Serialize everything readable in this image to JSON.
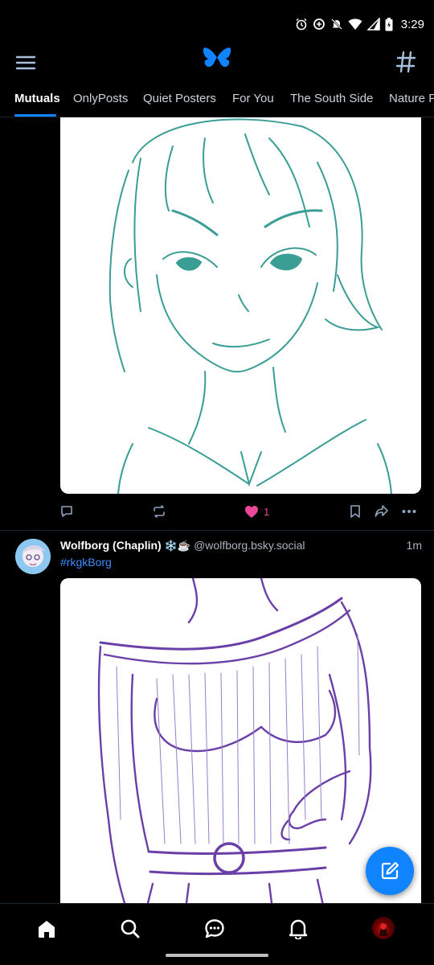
{
  "status_bar": {
    "time": "3:29",
    "icons": [
      "alarm-icon",
      "data-saver-icon",
      "bell-off-icon",
      "wifi-icon",
      "signal-icon",
      "battery-icon"
    ]
  },
  "header": {
    "menu_icon": "hamburger-menu-icon",
    "logo_icon": "butterfly-logo-icon",
    "feeds_icon": "hash-icon"
  },
  "tabs": [
    {
      "label": "Mutuals",
      "active": true
    },
    {
      "label": "OnlyPosts",
      "active": false
    },
    {
      "label": "Quiet Posters",
      "active": false
    },
    {
      "label": "For You",
      "active": false
    },
    {
      "label": "The South Side",
      "active": false
    },
    {
      "label": "Nature P",
      "active": false
    }
  ],
  "posts": [
    {
      "image": "teal-line-sketch",
      "actions": {
        "reply_icon": "reply-icon",
        "repost_icon": "repost-icon",
        "like_icon": "heart-icon",
        "like_count": "1",
        "bookmark_icon": "bookmark-icon",
        "share_icon": "share-icon",
        "more_icon": "more-icon"
      }
    },
    {
      "author": "Wolfborg (Chaplin)",
      "emoji": "❄️☕",
      "handle": "@wolfborg.bsky.social",
      "time": "1m",
      "hashtag": "#rkgkBorg",
      "image": "purple-line-sketch"
    }
  ],
  "fab": {
    "icon": "compose-icon"
  },
  "bottom_nav": [
    "home-icon",
    "search-icon",
    "chat-icon",
    "notifications-icon",
    "profile-avatar"
  ],
  "colors": {
    "accent": "#1083fe",
    "background": "#000000",
    "like": "#ec4899",
    "hashtag": "#3d8dff",
    "muted": "#a8b3c1",
    "sketch_teal": "#3a9e95",
    "sketch_purple": "#6b3fa8"
  }
}
